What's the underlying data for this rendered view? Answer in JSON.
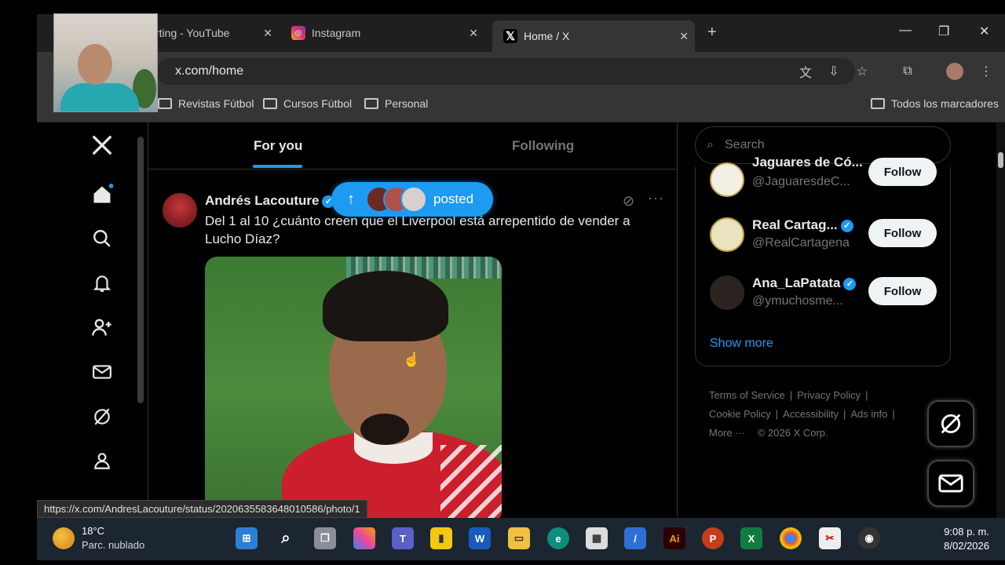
{
  "browser": {
    "tabs": [
      {
        "label": "rting - YouTube"
      },
      {
        "label": "Instagram"
      },
      {
        "label": "Home / X"
      }
    ],
    "address": "x.com/home",
    "bookmarks": [
      "Revistas Fútbol",
      "Cursos Fútbol",
      "Personal"
    ],
    "all_bookmarks": "Todos los marcadores",
    "status_url": "https://x.com/AndresLacouture/status/2020635583648010586/photo/1"
  },
  "feed": {
    "tabs": [
      "For you",
      "Following"
    ],
    "new_posts_label": "posted",
    "post": {
      "author": "Andrés Lacouture",
      "text": "Del 1 al 10 ¿cuánto creen que el Liverpool está arrepentido de vender a Lucho Díaz?"
    }
  },
  "sidebar": {
    "search_placeholder": "Search",
    "who_to_follow": [
      {
        "name": "Jaguares de Có...",
        "handle": "@JaguaresdeC...",
        "button": "Follow"
      },
      {
        "name": "Real Cartag...",
        "handle": "@RealCartagena",
        "button": "Follow"
      },
      {
        "name": "Ana_LaPatata",
        "handle": "@ymuchosme...",
        "button": "Follow"
      }
    ],
    "show_more": "Show more",
    "footer": {
      "terms": "Terms of Service",
      "privacy": "Privacy Policy",
      "cookie": "Cookie Policy",
      "accessibility": "Accessibility",
      "ads": "Ads info",
      "more": "More ···",
      "copyright": "© 2026 X Corp."
    }
  },
  "taskbar": {
    "temperature": "18°C",
    "condition": "Parc. nublado",
    "time": "9:08 p. m.",
    "date": "8/02/2026"
  },
  "colors": {
    "accent": "#1d9bf0",
    "background": "#000000"
  }
}
